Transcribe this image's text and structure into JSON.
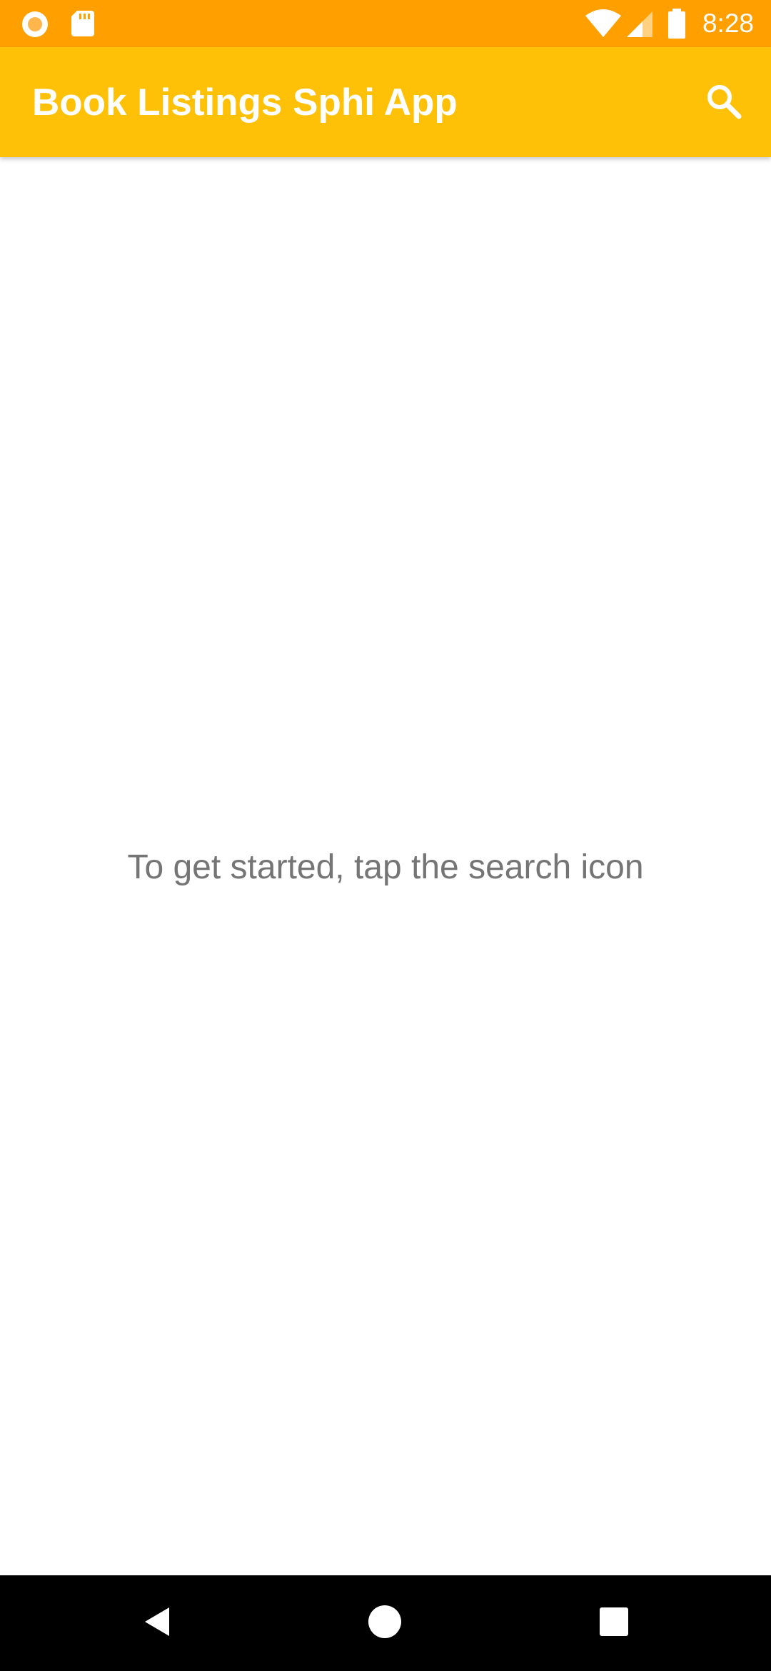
{
  "status_bar": {
    "time": "8:28",
    "icons": [
      "notification-dot-icon",
      "sd-card-icon",
      "wifi-icon",
      "cell-signal-icon",
      "battery-icon"
    ],
    "background_color": "#FFA000"
  },
  "app_bar": {
    "title": "Book Listings Sphi App",
    "action_icon": "search-icon",
    "background_color": "#FFC107"
  },
  "main": {
    "empty_message": "To get started, tap the search icon"
  },
  "nav_bar": {
    "buttons": [
      "back-icon",
      "home-icon",
      "recents-icon"
    ]
  }
}
